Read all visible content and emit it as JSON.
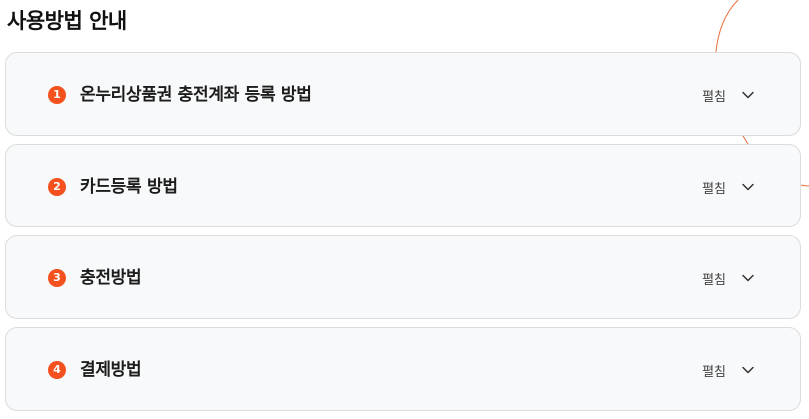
{
  "page": {
    "title": "사용방법 안내",
    "accent_color": "#f4511e"
  },
  "accordion": {
    "items": [
      {
        "number": "1",
        "title": "온누리상품권 충전계좌 등록 방법",
        "toggle_label": "펼침",
        "icon": "chevron-down-icon"
      },
      {
        "number": "2",
        "title": "카드등록 방법",
        "toggle_label": "펼침",
        "icon": "chevron-down-icon"
      },
      {
        "number": "3",
        "title": "충전방법",
        "toggle_label": "펼침",
        "icon": "chevron-down-icon"
      },
      {
        "number": "4",
        "title": "결제방법",
        "toggle_label": "펼침",
        "icon": "chevron-down-icon"
      }
    ]
  }
}
